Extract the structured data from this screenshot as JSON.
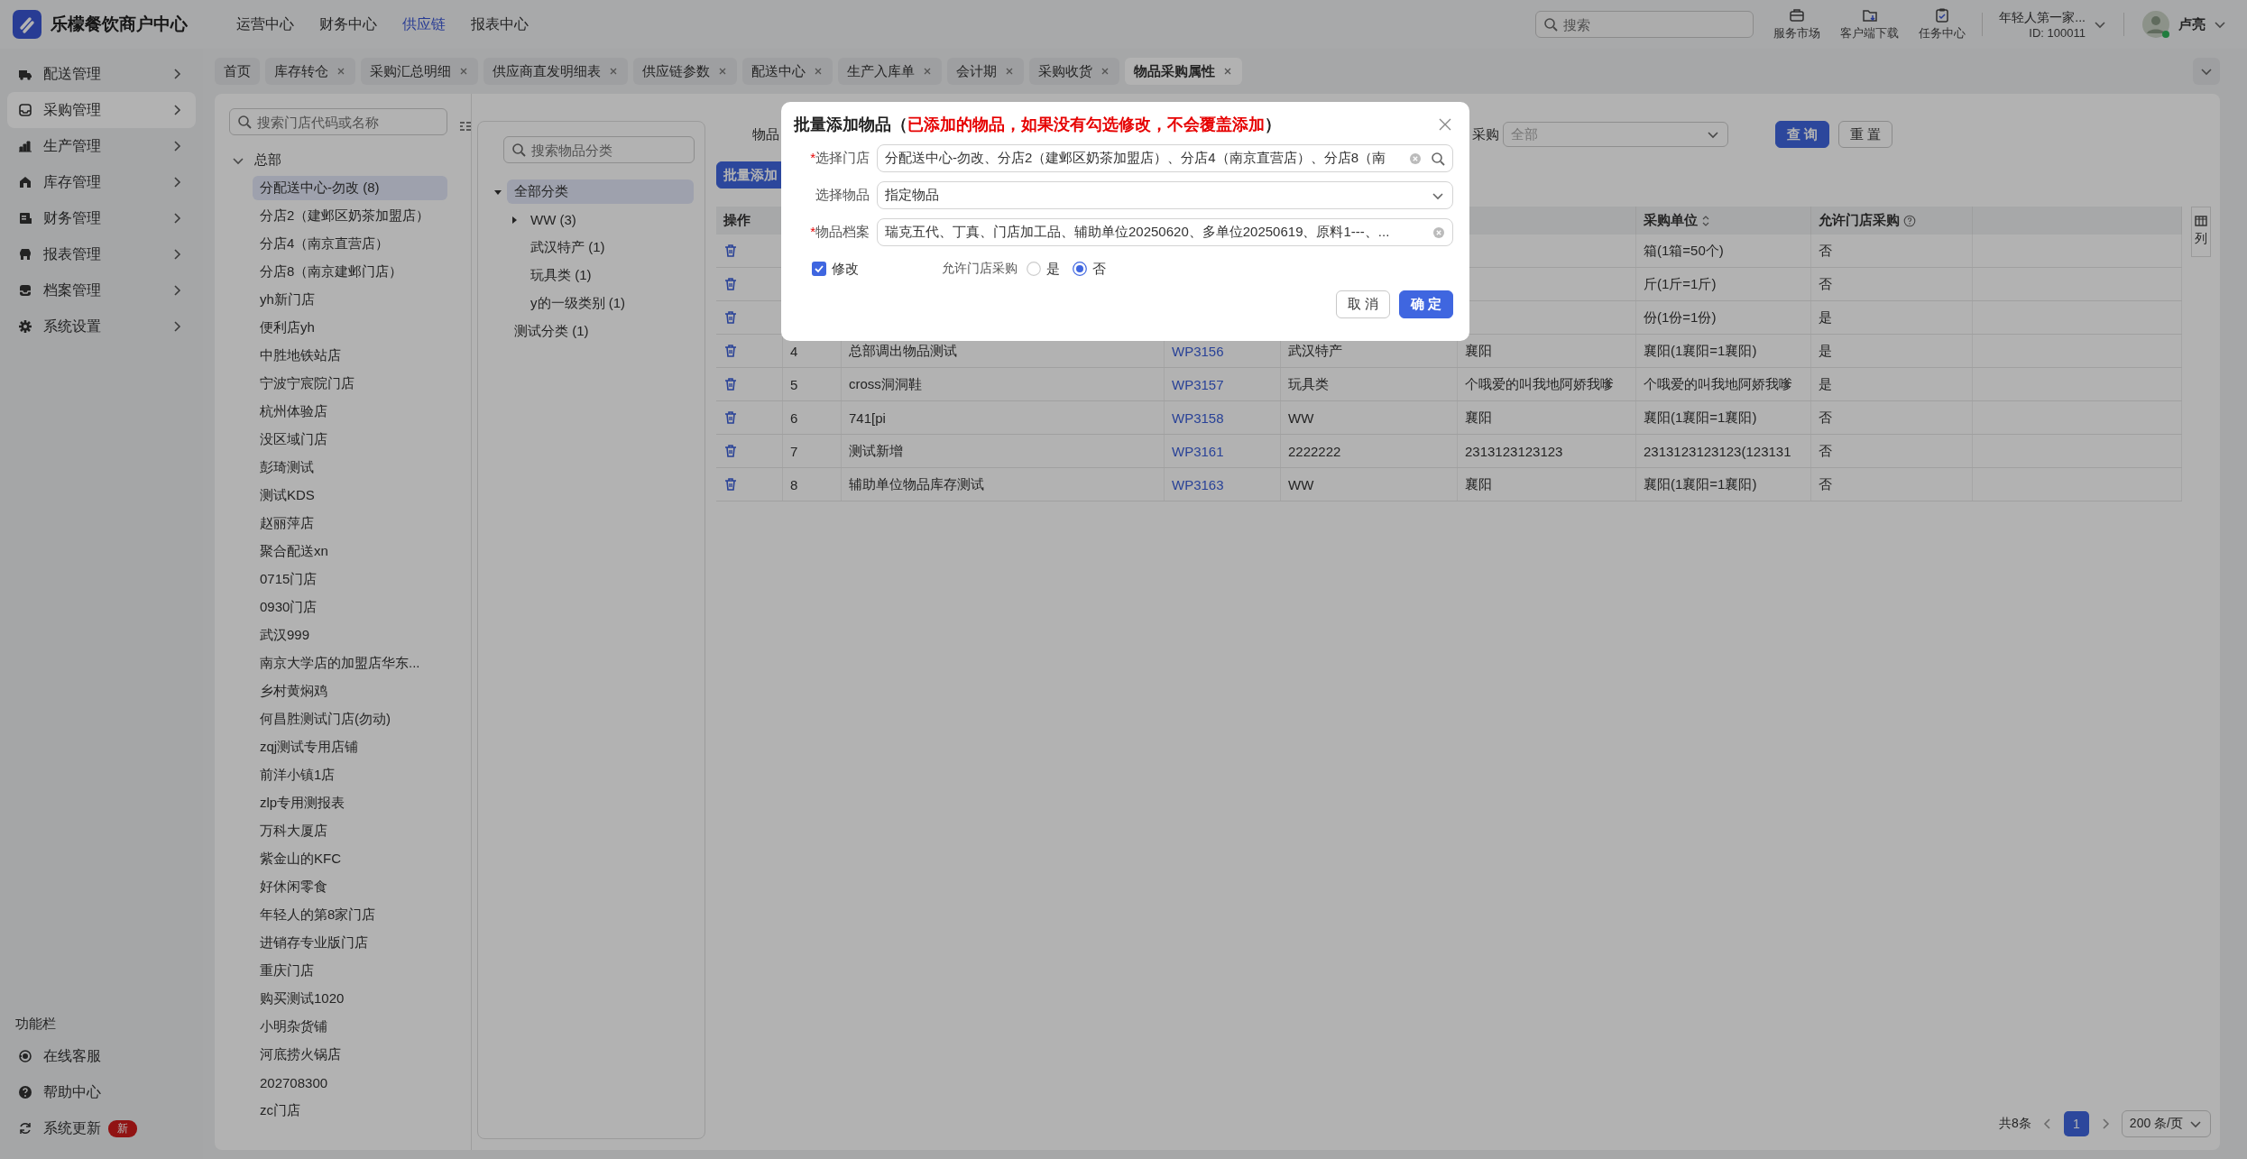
{
  "header": {
    "logo_text": "乐檬餐饮商户中心",
    "nav": [
      {
        "label": "运营中心",
        "selected": false
      },
      {
        "label": "财务中心",
        "selected": false
      },
      {
        "label": "供应链",
        "selected": true
      },
      {
        "label": "报表中心",
        "selected": false
      }
    ],
    "search": {
      "placeholder": "搜索"
    },
    "tools": [
      {
        "label": "服务市场"
      },
      {
        "label": "客户端下载"
      },
      {
        "label": "任务中心"
      }
    ],
    "account": {
      "name": "年轻人第一家...",
      "id": "ID: 100011"
    },
    "user": {
      "name": "卢亮"
    }
  },
  "sidebar": {
    "items": [
      {
        "label": "配送管理",
        "selected": false
      },
      {
        "label": "采购管理",
        "selected": true
      },
      {
        "label": "生产管理",
        "selected": false
      },
      {
        "label": "库存管理",
        "selected": false
      },
      {
        "label": "财务管理",
        "selected": false
      },
      {
        "label": "报表管理",
        "selected": false
      },
      {
        "label": "档案管理",
        "selected": false
      },
      {
        "label": "系统设置",
        "selected": false
      }
    ],
    "footer_title": "功能栏",
    "footer_items": [
      {
        "label": "在线客服"
      },
      {
        "label": "帮助中心"
      },
      {
        "label": "系统更新",
        "badge": "新"
      }
    ]
  },
  "tabs": [
    {
      "label": "首页",
      "closable": false,
      "selected": false
    },
    {
      "label": "库存转仓",
      "closable": true,
      "selected": false
    },
    {
      "label": "采购汇总明细",
      "closable": true,
      "selected": false
    },
    {
      "label": "供应商直发明细表",
      "closable": true,
      "selected": false
    },
    {
      "label": "供应链参数",
      "closable": true,
      "selected": false
    },
    {
      "label": "配送中心",
      "closable": true,
      "selected": false
    },
    {
      "label": "生产入库单",
      "closable": true,
      "selected": false
    },
    {
      "label": "会计期",
      "closable": true,
      "selected": false
    },
    {
      "label": "采购收货",
      "closable": true,
      "selected": false
    },
    {
      "label": "物品采购属性",
      "closable": true,
      "selected": true
    }
  ],
  "store_tree": {
    "search_placeholder": "搜索门店代码或名称",
    "nodes": [
      {
        "label": "总部",
        "expanded": true,
        "selected": false,
        "children": [
          {
            "label": "分配送中心-勿改 (8)",
            "selected": true
          },
          {
            "label": "分店2（建邺区奶茶加盟店）",
            "selected": false
          },
          {
            "label": "分店4（南京直营店）",
            "selected": false
          },
          {
            "label": "分店8（南京建邺门店）",
            "selected": false
          },
          {
            "label": "yh新门店",
            "selected": false
          },
          {
            "label": "便利店yh",
            "selected": false
          },
          {
            "label": "中胜地铁站店",
            "selected": false
          },
          {
            "label": "宁波宁宸院门店",
            "selected": false
          },
          {
            "label": "杭州体验店",
            "selected": false
          },
          {
            "label": "没区域门店",
            "selected": false
          },
          {
            "label": "彭琦测试",
            "selected": false
          },
          {
            "label": "测试KDS",
            "selected": false
          },
          {
            "label": "赵丽萍店",
            "selected": false
          },
          {
            "label": "聚合配送xn",
            "selected": false
          },
          {
            "label": "0715门店",
            "selected": false
          },
          {
            "label": "0930门店",
            "selected": false
          },
          {
            "label": "武汉999",
            "selected": false
          },
          {
            "label": "南京大学店的加盟店华东...",
            "selected": false
          },
          {
            "label": "乡村黄焖鸡",
            "selected": false
          },
          {
            "label": "何昌胜测试门店(勿动)",
            "selected": false
          },
          {
            "label": "zqj测试专用店铺",
            "selected": false
          },
          {
            "label": "前洋小镇1店",
            "selected": false
          },
          {
            "label": "zlp专用测报表",
            "selected": false
          },
          {
            "label": "万科大厦店",
            "selected": false
          },
          {
            "label": "紫金山的KFC",
            "selected": false
          },
          {
            "label": "好休闲零食",
            "selected": false
          },
          {
            "label": "年轻人的第8家门店",
            "selected": false
          },
          {
            "label": "进销存专业版门店",
            "selected": false
          },
          {
            "label": "重庆门店",
            "selected": false
          },
          {
            "label": "购买测试1020",
            "selected": false
          },
          {
            "label": "小明杂货铺",
            "selected": false
          },
          {
            "label": "河底捞火锅店",
            "selected": false
          },
          {
            "label": "202708300",
            "selected": false
          },
          {
            "label": "zc门店",
            "selected": false
          }
        ]
      }
    ]
  },
  "category_tree": {
    "search_placeholder": "搜索物品分类",
    "nodes": [
      {
        "label": "全部分类",
        "expanded": true,
        "selected": true,
        "children": [
          {
            "label": "WW (3)",
            "expanded": false,
            "selected": false
          },
          {
            "label": "武汉特产 (1)",
            "selected": false
          },
          {
            "label": "玩具类 (1)",
            "selected": false
          },
          {
            "label": "y的一级类别 (1)",
            "selected": false
          }
        ]
      },
      {
        "label": "测试分类 (1)",
        "selected": false
      }
    ]
  },
  "filters": {
    "label_1": "物品",
    "label_2": "采购",
    "select_value": "全部",
    "buttons": [
      {
        "label": "查 询",
        "kind": "primary"
      },
      {
        "label": "重 置",
        "kind": "default"
      }
    ]
  },
  "batch_button": "批量添加",
  "table": {
    "columns": [
      {
        "label": "操作",
        "kind": "action"
      },
      {
        "kind": "text"
      },
      {
        "kind": "text"
      },
      {
        "kind": "link"
      },
      {
        "kind": "text"
      },
      {
        "kind": "text"
      },
      {
        "label": "采购单位",
        "kind": "text",
        "sortable": true
      },
      {
        "label": "允许门店采购",
        "kind": "text",
        "help": true
      }
    ],
    "rows": [
      {
        "values": [
          "箱(1箱=50个)",
          "否"
        ]
      },
      {
        "values": [
          "斤(1斤=1斤)",
          "否"
        ]
      },
      {
        "values": [
          "份(1份=1份)",
          "是"
        ]
      },
      {
        "values": [
          "4",
          "总部调出物品测试",
          "WP3156",
          "武汉特产",
          "襄阳",
          "襄阳(1襄阳=1襄阳)",
          "是"
        ]
      },
      {
        "values": [
          "5",
          "cross洞洞鞋",
          "WP3157",
          "玩具类",
          "个哦爱的叫我地阿娇我嗲",
          "个哦爱的叫我地阿娇我嗲",
          "是"
        ]
      },
      {
        "values": [
          "6",
          "741[pi",
          "WP3158",
          "WW",
          "襄阳",
          "襄阳(1襄阳=1襄阳)",
          "否"
        ]
      },
      {
        "values": [
          "7",
          "测试新增",
          "WP3161",
          "2222222",
          "2313123123123",
          "2313123123123(123131",
          "否"
        ]
      },
      {
        "values": [
          "8",
          "辅助单位物品库存测试",
          "WP3163",
          "WW",
          "襄阳",
          "襄阳(1襄阳=1襄阳)",
          "否"
        ]
      }
    ]
  },
  "column_setting": "列",
  "pagination": {
    "total": "共8条",
    "pages": [
      {
        "label": "1",
        "selected": true
      }
    ],
    "page_size": "200 条/页"
  },
  "dialog": {
    "title": "批量添加物品（",
    "note": "已添加的物品，如果没有勾选修改，不会覆盖添加",
    "title_end": "）",
    "fields": [
      {
        "required_mark": "*",
        "label": "选择门店",
        "value": "分配送中心-勿改、分店2（建邺区奶茶加盟店）、分店4（南京直营店）、分店8（南",
        "kind": "search"
      },
      {
        "label": "选择物品",
        "value": "指定物品",
        "kind": "select"
      },
      {
        "required_mark": "*",
        "label": "物品档案",
        "value": "瑞克五代、丁真、门店加工品、辅助单位20250620、多单位20250619、原料1---、...",
        "kind": "picker"
      }
    ],
    "modify": {
      "label": "修改",
      "checked": true
    },
    "allow": {
      "label": "允许门店采购",
      "options": [
        {
          "label": "是",
          "selected": false
        },
        {
          "label": "否",
          "selected": true
        }
      ]
    },
    "buttons": [
      {
        "label": "取 消",
        "kind": "default"
      },
      {
        "label": "确 定",
        "kind": "primary"
      }
    ]
  }
}
